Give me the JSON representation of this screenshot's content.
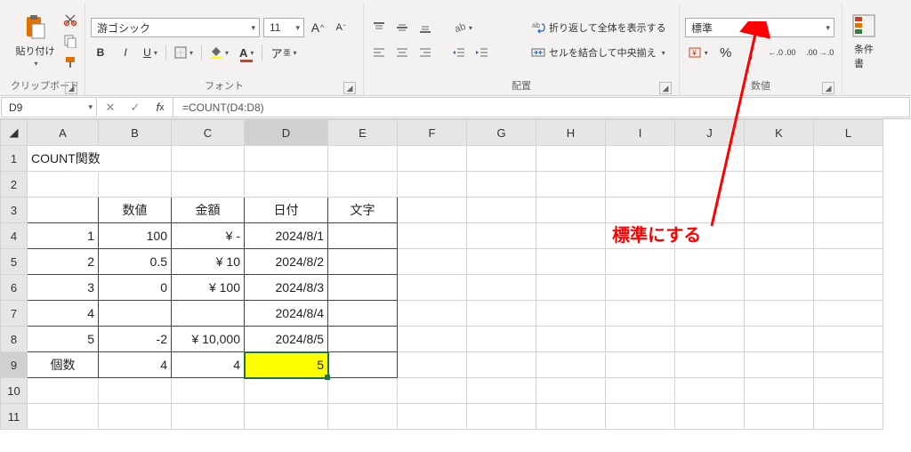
{
  "ribbon": {
    "clipboard": {
      "label": "クリップボード",
      "paste": "貼り付け"
    },
    "font": {
      "label": "フォント",
      "name": "游ゴシック",
      "size": "11",
      "bold": "B",
      "italic": "I",
      "underline": "U"
    },
    "alignment": {
      "label": "配置",
      "wrap": "折り返して全体を表示する",
      "merge": "セルを結合して中央揃え"
    },
    "number": {
      "label": "数値",
      "format": "標準",
      "percent": "%",
      "comma": ",",
      "inc_dec": "←0 .00",
      "dec_dec": ".00 →0"
    },
    "cond": {
      "label1": "条件",
      "label2": "書"
    }
  },
  "formula_bar": {
    "name_box": "D9",
    "formula": "=COUNT(D4:D8)"
  },
  "columns": [
    "A",
    "B",
    "C",
    "D",
    "E",
    "F",
    "G",
    "H",
    "I",
    "J",
    "K",
    "L"
  ],
  "grid": {
    "title": "COUNT関数",
    "headers": {
      "b": "数値",
      "c": "金額",
      "d": "日付",
      "e": "文字"
    },
    "rows": [
      {
        "a": "1",
        "b": "100",
        "c": "¥        -",
        "d": "2024/8/1",
        "e": ""
      },
      {
        "a": "2",
        "b": "0.5",
        "c": "¥      10",
        "d": "2024/8/2",
        "e": ""
      },
      {
        "a": "3",
        "b": "0",
        "c": "¥    100",
        "d": "2024/8/3",
        "e": ""
      },
      {
        "a": "4",
        "b": "",
        "c": "",
        "d": "2024/8/4",
        "e": ""
      },
      {
        "a": "5",
        "b": "-2",
        "c": "¥ 10,000",
        "d": "2024/8/5",
        "e": ""
      }
    ],
    "footer": {
      "a": "個数",
      "b": "4",
      "c": "4",
      "d": "5",
      "e": ""
    }
  },
  "annotation": {
    "text": "標準にする"
  }
}
